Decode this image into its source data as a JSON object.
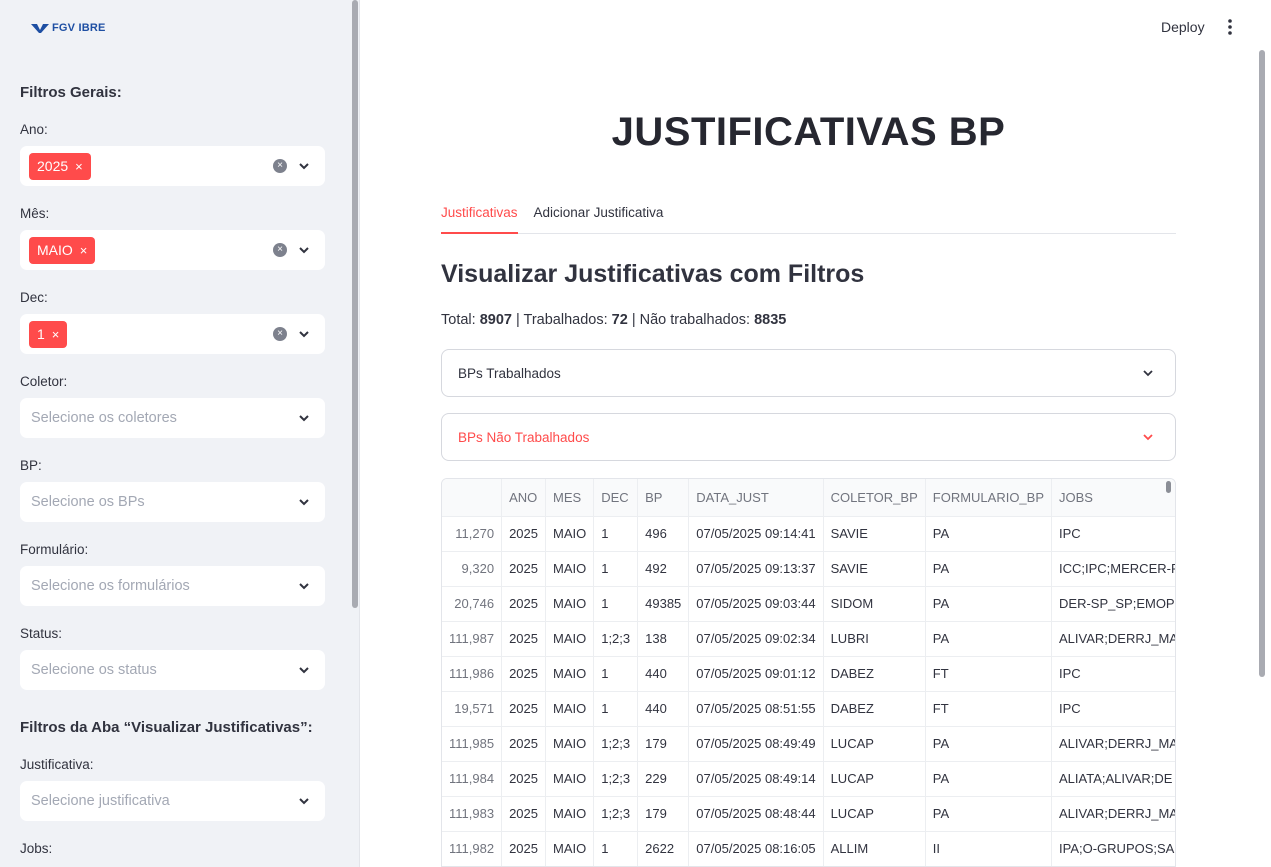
{
  "sidebar": {
    "logo_text": "FGV IBRE",
    "section_general": "Filtros Gerais:",
    "filters": [
      {
        "label": "Ano:",
        "chip": "2025",
        "placeholder": ""
      },
      {
        "label": "Mês:",
        "chip": "MAIO",
        "placeholder": ""
      },
      {
        "label": "Dec:",
        "chip": "1",
        "placeholder": ""
      },
      {
        "label": "Coletor:",
        "chip": "",
        "placeholder": "Selecione os coletores"
      },
      {
        "label": "BP:",
        "chip": "",
        "placeholder": "Selecione os BPs"
      },
      {
        "label": "Formulário:",
        "chip": "",
        "placeholder": "Selecione os formulários"
      },
      {
        "label": "Status:",
        "chip": "",
        "placeholder": "Selecione os status"
      }
    ],
    "section_tab": "Filtros da Aba “Visualizar Justificativas”:",
    "tab_filters": [
      {
        "label": "Justificativa:",
        "placeholder": "Selecione justificativa"
      },
      {
        "label": "Jobs:"
      }
    ],
    "chip_remove": "×",
    "clear_icon": "×"
  },
  "header": {
    "deploy_label": "Deploy"
  },
  "main": {
    "title": "JUSTIFICATIVAS BP",
    "tabs": [
      {
        "label": "Justificativas",
        "active": true
      },
      {
        "label": "Adicionar Justificativa",
        "active": false
      }
    ],
    "subtitle": "Visualizar Justificativas com Filtros",
    "totals": {
      "total_label": "Total: ",
      "total": "8907",
      "worked_label": "Trabalhados: ",
      "worked": "72",
      "not_worked_label": "Não trabalhados: ",
      "not_worked": "8835",
      "sep": " | "
    },
    "expanders": [
      {
        "label": "BPs Trabalhados",
        "color": "#31333f"
      },
      {
        "label": "BPs Não Trabalhados",
        "color": "#ff4b4b"
      }
    ]
  },
  "table": {
    "columns": [
      "",
      "ANO",
      "MES",
      "DEC",
      "BP",
      "DATA_JUST",
      "COLETOR_BP",
      "FORMULARIO_BP",
      "JOBS"
    ],
    "rows": [
      [
        "11,270",
        "2025",
        "MAIO",
        "1",
        "496",
        "07/05/2025 09:14:41",
        "SAVIE",
        "PA",
        "IPC"
      ],
      [
        "9,320",
        "2025",
        "MAIO",
        "1",
        "492",
        "07/05/2025 09:13:37",
        "SAVIE",
        "PA",
        "ICC;IPC;MERCER-R"
      ],
      [
        "20,746",
        "2025",
        "MAIO",
        "1",
        "49385",
        "07/05/2025 09:03:44",
        "SIDOM",
        "PA",
        "DER-SP_SP;EMOP"
      ],
      [
        "111,987",
        "2025",
        "MAIO",
        "1;2;3",
        "138",
        "07/05/2025 09:02:34",
        "LUBRI",
        "PA",
        "ALIVAR;DERRJ_MA"
      ],
      [
        "111,986",
        "2025",
        "MAIO",
        "1",
        "440",
        "07/05/2025 09:01:12",
        "DABEZ",
        "FT",
        "IPC"
      ],
      [
        "19,571",
        "2025",
        "MAIO",
        "1",
        "440",
        "07/05/2025 08:51:55",
        "DABEZ",
        "FT",
        "IPC"
      ],
      [
        "111,985",
        "2025",
        "MAIO",
        "1;2;3",
        "179",
        "07/05/2025 08:49:49",
        "LUCAP",
        "PA",
        "ALIVAR;DERRJ_MA"
      ],
      [
        "111,984",
        "2025",
        "MAIO",
        "1;2;3",
        "229",
        "07/05/2025 08:49:14",
        "LUCAP",
        "PA",
        "ALIATA;ALIVAR;DE"
      ],
      [
        "111,983",
        "2025",
        "MAIO",
        "1;2;3",
        "179",
        "07/05/2025 08:48:44",
        "LUCAP",
        "PA",
        "ALIVAR;DERRJ_MA"
      ],
      [
        "111,982",
        "2025",
        "MAIO",
        "1",
        "2622",
        "07/05/2025 08:16:05",
        "ALLIM",
        "II",
        "IPA;O-GRUPOS;SA"
      ]
    ]
  },
  "colors": {
    "accent": "#ff4b4b",
    "sidebar_bg": "#f0f2f6",
    "text": "#31333f"
  }
}
